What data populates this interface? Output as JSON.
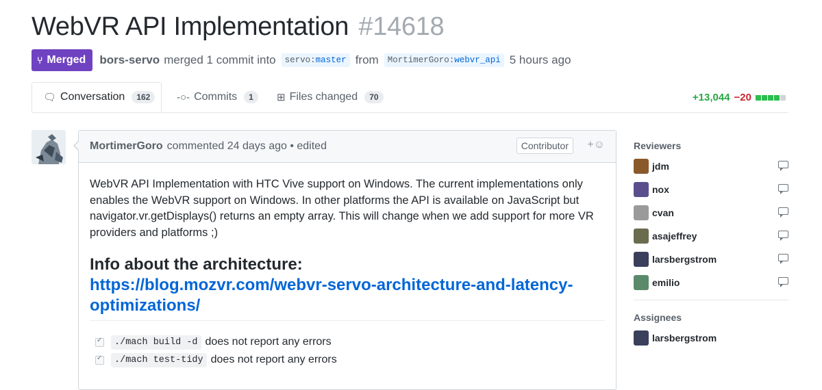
{
  "pr": {
    "title": "WebVR API Implementation",
    "number": "#14618",
    "status": "Merged",
    "merged_by": "bors-servo",
    "merge_text": "merged 1 commit into",
    "base_owner": "servo",
    "base_branch": "master",
    "from_text": "from",
    "head_owner": "MortimerGoro",
    "head_branch": "webvr_api",
    "time_ago": "5 hours ago"
  },
  "tabs": [
    {
      "label": "Conversation",
      "count": "162",
      "icon": "comment-discussion-icon"
    },
    {
      "label": "Commits",
      "count": "1",
      "icon": "git-commit-icon"
    },
    {
      "label": "Files changed",
      "count": "70",
      "icon": "diff-icon"
    }
  ],
  "diffstat": {
    "additions": "+13,044",
    "deletions": "−20",
    "colors": {
      "add": "#2cbe4e",
      "del": "#cb2431",
      "neutral": "#d1d5da"
    }
  },
  "comment": {
    "author": "MortimerGoro",
    "header_text": "commented 24 days ago • edited",
    "role_badge": "Contributor",
    "reaction": "+☺",
    "paragraph": "WebVR API Implementation with HTC Vive support on Windows. The current implementations only enables the WebVR support on Windows. In other platforms the API is available on JavaScript but navigator.vr.getDisplays() returns an empty array. This will change when we add support for more VR providers and platforms ;)",
    "heading": "Info about the architecture:",
    "link": "https://blog.mozvr.com/webvr-servo-architecture-and-latency-optimizations/",
    "tasks": [
      {
        "code": "./mach build -d",
        "text": "does not report any errors"
      },
      {
        "code": "./mach test-tidy",
        "text": "does not report any errors"
      }
    ]
  },
  "sidebar": {
    "reviewers_title": "Reviewers",
    "reviewers": [
      {
        "name": "jdm",
        "color": "#8a5a2b"
      },
      {
        "name": "nox",
        "color": "#5b4e8c"
      },
      {
        "name": "cvan",
        "color": "#9a9a9a"
      },
      {
        "name": "asajeffrey",
        "color": "#6b6b4e"
      },
      {
        "name": "larsbergstrom",
        "color": "#3a3f5c"
      },
      {
        "name": "emilio",
        "color": "#5a8a6a"
      }
    ],
    "assignees_title": "Assignees",
    "assignees": [
      {
        "name": "larsbergstrom",
        "color": "#3a3f5c"
      }
    ]
  }
}
